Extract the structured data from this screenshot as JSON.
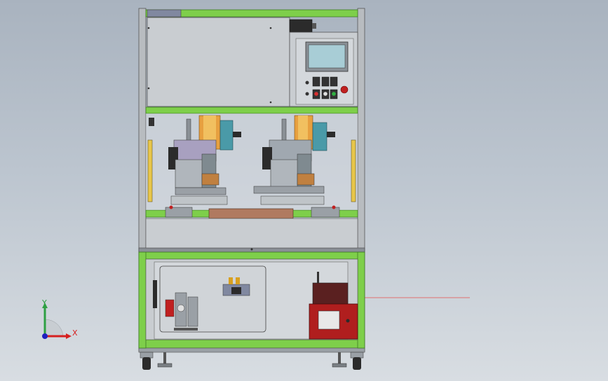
{
  "scene": {
    "background_top": "#a9b3bf",
    "background_bottom": "#d8dde2",
    "frame_color": "#7ecf4a",
    "panel_color": "#c9cdd1",
    "hmi_screen_color": "#a8cdd6",
    "electrical_box_color": "#b01e1e",
    "reference_line_color": "#e07070"
  },
  "triad": {
    "y_label": "Y",
    "x_label": "X",
    "y_color": "#2ea043",
    "x_color": "#d62020",
    "z_color": "#2020c0"
  }
}
